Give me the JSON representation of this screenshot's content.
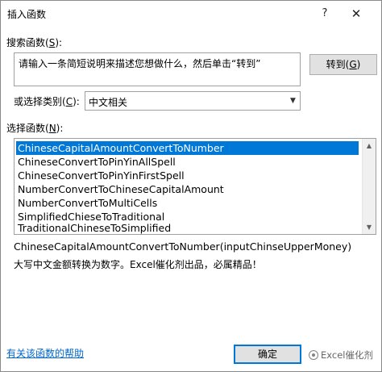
{
  "window": {
    "title": "插入函数",
    "help_glyph": "?",
    "close_glyph": "✕"
  },
  "search": {
    "label_prefix": "搜索函数(",
    "label_key": "S",
    "label_suffix": "):",
    "value": "请输入一条简短说明来描述您想做什么，然后单击“转到”",
    "go_prefix": "转到(",
    "go_key": "G",
    "go_suffix": ")"
  },
  "category": {
    "label_prefix": "或选择类别(",
    "label_key": "C",
    "label_suffix": "):",
    "selected": "中文相关",
    "arrow_glyph": "▼"
  },
  "functions": {
    "label_prefix": "选择函数(",
    "label_key": "N",
    "label_suffix": "):",
    "items": [
      "ChineseCapitalAmountConvertToNumber",
      "ChineseConvertToPinYinAllSpell",
      "ChineseConvertToPinYinFirstSpell",
      "NumberConvertToChineseCapitalAmount",
      "NumberConvertToMultiCells",
      "SimplifiedChieseToTraditional",
      "TraditionalChineseToSimplified"
    ],
    "selected_index": 0,
    "scroll_up_glyph": "▲",
    "scroll_down_glyph": "▼"
  },
  "details": {
    "signature": "ChineseCapitalAmountConvertToNumber(inputChinseUpperMoney)",
    "description": "大写中文金额转换为数字。Excel催化剂出品，必属精品！"
  },
  "footer": {
    "help_link": "有关该函数的帮助",
    "ok_label": "确定",
    "watermark": "Excel催化剂"
  },
  "colors": {
    "selection": "#0078d7",
    "link": "#0066cc",
    "button_face": "#e1e1e1"
  }
}
